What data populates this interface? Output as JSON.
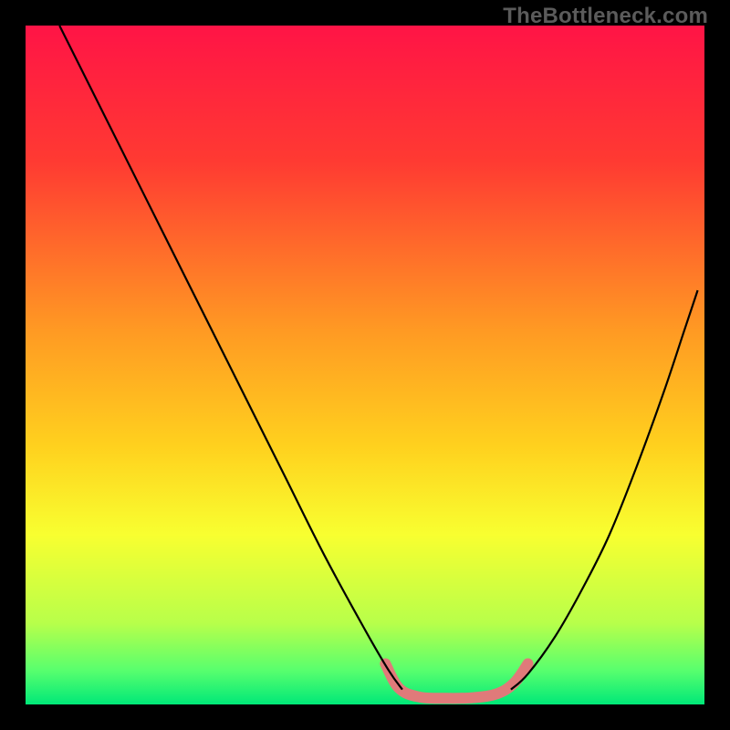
{
  "watermark": "TheBottleneck.com",
  "chart_data": {
    "type": "line",
    "title": "",
    "xlabel": "",
    "ylabel": "",
    "xlim": [
      0,
      100
    ],
    "ylim": [
      0,
      100
    ],
    "gradient_stops": [
      {
        "offset": 0,
        "color": "#ff1446"
      },
      {
        "offset": 20,
        "color": "#ff3a32"
      },
      {
        "offset": 45,
        "color": "#ff9a23"
      },
      {
        "offset": 62,
        "color": "#ffd11e"
      },
      {
        "offset": 75,
        "color": "#f8ff30"
      },
      {
        "offset": 88,
        "color": "#b8ff4a"
      },
      {
        "offset": 95,
        "color": "#58ff6e"
      },
      {
        "offset": 100,
        "color": "#00e878"
      }
    ],
    "series": [
      {
        "name": "curve-left",
        "type": "line",
        "stroke": "#000000",
        "width": 2.2,
        "points": [
          {
            "x": 5.0,
            "y": 100.0
          },
          {
            "x": 10.0,
            "y": 90.0
          },
          {
            "x": 17.0,
            "y": 76.0
          },
          {
            "x": 24.0,
            "y": 62.0
          },
          {
            "x": 31.0,
            "y": 48.0
          },
          {
            "x": 38.0,
            "y": 34.0
          },
          {
            "x": 44.0,
            "y": 22.0
          },
          {
            "x": 50.0,
            "y": 11.0
          },
          {
            "x": 53.5,
            "y": 5.0
          },
          {
            "x": 55.5,
            "y": 2.2
          }
        ]
      },
      {
        "name": "curve-right",
        "type": "line",
        "stroke": "#000000",
        "width": 2.2,
        "points": [
          {
            "x": 71.5,
            "y": 2.2
          },
          {
            "x": 74.0,
            "y": 4.5
          },
          {
            "x": 78.0,
            "y": 10.0
          },
          {
            "x": 82.0,
            "y": 17.0
          },
          {
            "x": 86.0,
            "y": 25.0
          },
          {
            "x": 90.0,
            "y": 35.0
          },
          {
            "x": 94.0,
            "y": 46.0
          },
          {
            "x": 97.0,
            "y": 55.0
          },
          {
            "x": 99.0,
            "y": 61.0
          }
        ]
      },
      {
        "name": "highlight-band",
        "type": "line",
        "stroke": "#e07a7a",
        "width": 12,
        "linecap": "round",
        "points": [
          {
            "x": 53.0,
            "y": 6.0
          },
          {
            "x": 55.0,
            "y": 2.4
          },
          {
            "x": 58.0,
            "y": 1.1
          },
          {
            "x": 62.0,
            "y": 0.9
          },
          {
            "x": 66.0,
            "y": 1.0
          },
          {
            "x": 69.5,
            "y": 1.6
          },
          {
            "x": 72.0,
            "y": 3.2
          },
          {
            "x": 74.0,
            "y": 6.0
          }
        ]
      }
    ]
  }
}
